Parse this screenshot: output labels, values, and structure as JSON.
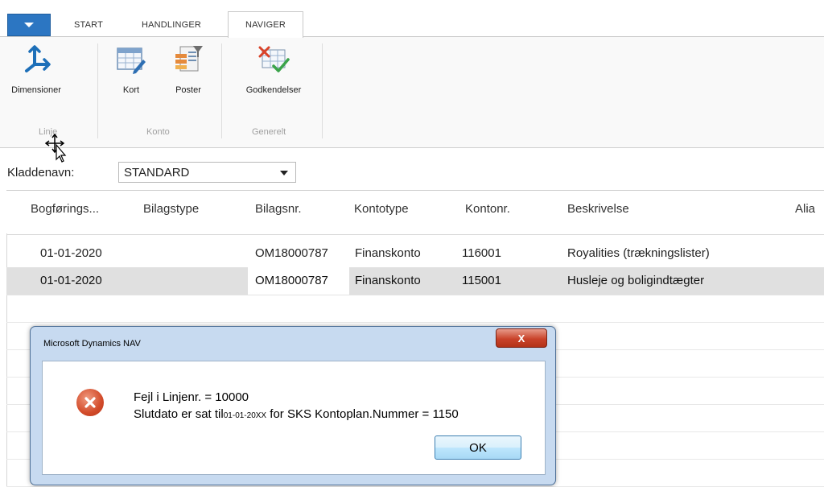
{
  "ribbon": {
    "tabs": [
      {
        "label": "START"
      },
      {
        "label": "HANDLINGER"
      },
      {
        "label": "NAVIGER"
      }
    ],
    "buttons": {
      "dimensioner": "Dimensioner",
      "kort": "Kort",
      "poster": "Poster",
      "godkendelser": "Godkendelser"
    },
    "groups": {
      "linje": "Linje",
      "konto": "Konto",
      "generelt": "Generelt"
    }
  },
  "journal": {
    "label": "Kladdenavn:",
    "value": "STANDARD"
  },
  "grid": {
    "headers": [
      "Bogførings...",
      "Bilagstype",
      "Bilagsnr.",
      "Kontotype",
      "Kontonr.",
      "Beskrivelse",
      "Alia"
    ],
    "rows": [
      {
        "date": "01-01-2020",
        "doctype": "",
        "docno": "OM18000787",
        "accttype": "Finanskonto",
        "acctno": "116001",
        "desc": "Royalities (trækningslister)"
      },
      {
        "date": "01-01-2020",
        "doctype": "",
        "docno": "OM18000787",
        "accttype": "Finanskonto",
        "acctno": "115001",
        "desc": "Husleje og boligindtægter"
      }
    ]
  },
  "dialog": {
    "title": "Microsoft Dynamics NAV",
    "close_label": "X",
    "line1": "Fejl i Linjenr. = 10000",
    "line2_prefix": "Slutdato er sat til",
    "line2_date": "01-01-20XX",
    "line2_suffix": " for SKS Kontoplan.Nummer = 1150",
    "ok_label": "OK"
  },
  "colors": {
    "accent": "#2c76c2",
    "error": "#d24b2a",
    "selected_row": "#e0e0e0",
    "dialog_frame": "#c7daf0"
  },
  "icons": [
    "menu-dropdown-icon",
    "dimensions-icon",
    "card-icon",
    "entries-icon",
    "approvals-icon",
    "error-icon",
    "mouse-cursor-icon",
    "dropdown-arrow-icon"
  ]
}
